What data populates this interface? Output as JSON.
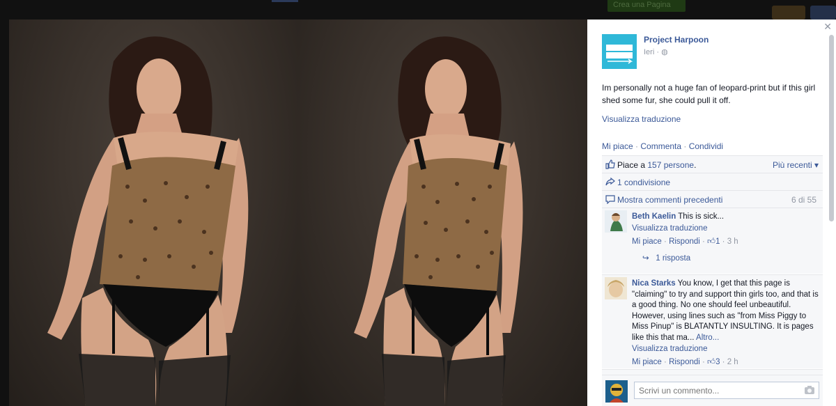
{
  "background_page": {
    "create_page_button": "Crea una Pagina"
  },
  "lightbox": {
    "close_icon": "close-icon"
  },
  "post": {
    "page_name": "Project Harpoon",
    "logo_text": "PROJECT HARPOON",
    "time": "Ieri · ",
    "privacy_icon": "globe-icon",
    "text": "Im personally not a huge fan of leopard-print but if this girl shed some fur, she could pull it off.",
    "translate_link": "Visualizza traduzione",
    "actions": {
      "like": "Mi piace",
      "comment": "Commenta",
      "share": "Condividi",
      "separator": " · "
    }
  },
  "ufi": {
    "likes_prefix": "Piace a ",
    "likes_link": "157 persone",
    "likes_suffix": ".",
    "sort_label": "Più recenti",
    "shares_link": "1 condivisione",
    "prev_comments_link": "Mostra commenti precedenti",
    "comment_count": "6 di 55"
  },
  "comments": [
    {
      "author": "Beth Kaelin",
      "text": "This is sick...",
      "translate": "Visualizza traduzione",
      "like": "Mi piace",
      "reply": "Rispondi",
      "likes": "1",
      "time": "3 h",
      "reply_count": "1 risposta"
    },
    {
      "author": "Nica Starks",
      "text": "You know, I get that this page is \"claiming\" to try and support thin girls too, and that is a good thing. No one should feel unbeautiful. However, using lines such as \"from Miss Piggy to Miss Pinup\" is BLATANTLY INSULTING. It is pages like this that ma...",
      "more": "Altro...",
      "translate": "Visualizza traduzione",
      "like": "Mi piace",
      "reply": "Rispondi",
      "likes": "3",
      "time": "2 h"
    }
  ],
  "composer": {
    "placeholder": "Scrivi un commento...",
    "camera_icon": "camera-icon"
  },
  "colors": {
    "link": "#3b5998",
    "muted": "#9197a3",
    "ufi_bg": "#f6f7f9",
    "logo_bg": "#2fb8d8"
  }
}
